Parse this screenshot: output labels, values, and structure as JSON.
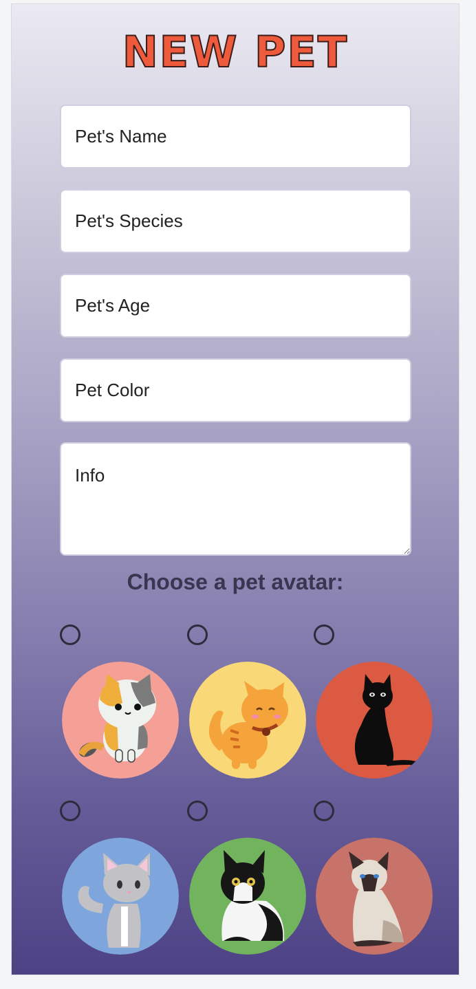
{
  "form": {
    "title": "NEW PET",
    "fields": {
      "name_placeholder": "Pet's Name",
      "species_placeholder": "Pet's Species",
      "age_placeholder": "Pet's Age",
      "color_placeholder": "Pet Color",
      "info_placeholder": "Info"
    },
    "avatar_prompt": "Choose a pet avatar:",
    "avatars": [
      {
        "icon": "calico-cat-icon",
        "bg": "#f4a096"
      },
      {
        "icon": "orange-tabby-cat-icon",
        "bg": "#f9d877"
      },
      {
        "icon": "black-cat-icon",
        "bg": "#dd5a42"
      },
      {
        "icon": "gray-cat-icon",
        "bg": "#7ea6dc"
      },
      {
        "icon": "tuxedo-cat-icon",
        "bg": "#72b35e"
      },
      {
        "icon": "siamese-cat-icon",
        "bg": "#c8736a"
      }
    ]
  },
  "colors": {
    "title": "#ee5a3c",
    "gradient_top": "#ebe9f1",
    "gradient_bottom": "#4d4284"
  }
}
